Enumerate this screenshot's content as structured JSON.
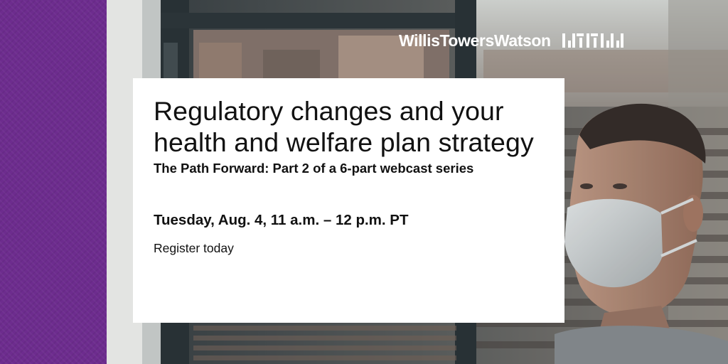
{
  "brand": {
    "name": "WillisTowersWatson",
    "accent_color": "#6d2c8e",
    "logo_icon": "wtw-bars-icon"
  },
  "event": {
    "title": "Regulatory changes and your health and welfare plan strategy",
    "subtitle": "The Path Forward: Part 2 of a 6-part webcast series",
    "date": "Tuesday, Aug. 4, 11 a.m. – 12 p.m. PT",
    "cta": "Register today"
  },
  "photo": {
    "icon": "man-wearing-face-mask-at-window-photo"
  }
}
